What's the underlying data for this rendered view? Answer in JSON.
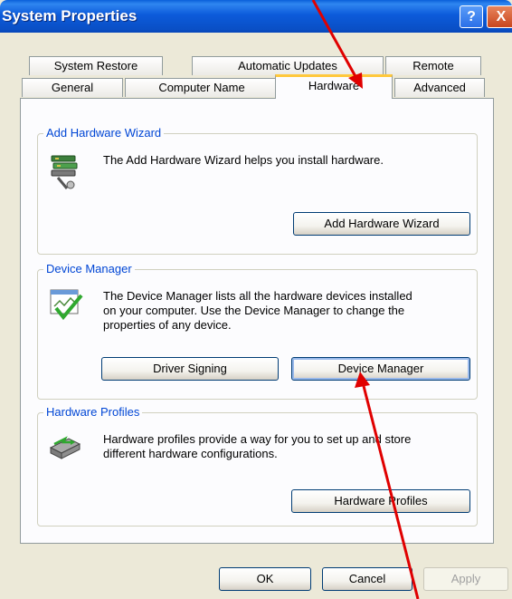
{
  "window": {
    "title": "System Properties",
    "help_label": "?",
    "close_label": "X"
  },
  "tabs": {
    "row1": [
      "System Restore",
      "Automatic Updates",
      "Remote"
    ],
    "row2": [
      "General",
      "Computer Name",
      "Hardware",
      "Advanced"
    ],
    "active": "Hardware"
  },
  "add_hardware": {
    "title": "Add Hardware Wizard",
    "description": "The Add Hardware Wizard helps you install hardware.",
    "button": "Add Hardware Wizard",
    "icon": "add-hardware-icon"
  },
  "device_manager": {
    "title": "Device Manager",
    "description_lines": [
      "The Device Manager lists all the hardware devices installed",
      "on your computer. Use the Device Manager to change the",
      "properties of any device."
    ],
    "driver_signing_button": "Driver Signing",
    "device_manager_button": "Device Manager",
    "icon": "device-manager-icon"
  },
  "hardware_profiles": {
    "title": "Hardware Profiles",
    "description_lines": [
      "Hardware profiles provide a way for you to set up and store",
      "different hardware configurations."
    ],
    "button": "Hardware Profiles",
    "icon": "hardware-profiles-icon"
  },
  "dialog_buttons": {
    "ok": "OK",
    "cancel": "Cancel",
    "apply": "Apply"
  },
  "colors": {
    "titlebar": "#0A5FD9",
    "group_title": "#0046D5",
    "active_tab_highlight": "#FFC83C",
    "annotation_arrow": "#E00000"
  }
}
